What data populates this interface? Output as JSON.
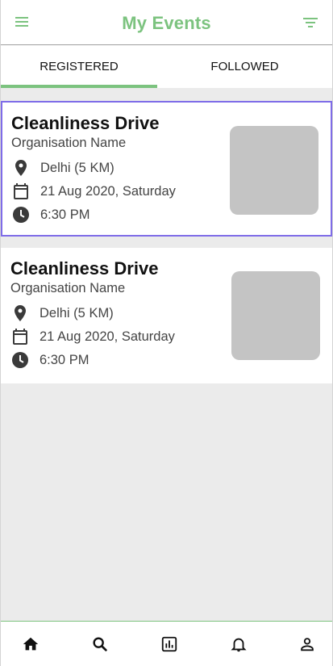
{
  "header": {
    "title": "My Events",
    "menu_icon": "hamburger-menu-icon",
    "filter_icon": "filter-icon"
  },
  "tabs": [
    {
      "label": "REGISTERED",
      "active": true
    },
    {
      "label": "FOLLOWED",
      "active": false
    }
  ],
  "events": [
    {
      "title": "Cleanliness Drive",
      "organisation": "Organisation Name",
      "location": "Delhi (5 KM)",
      "date": "21 Aug 2020, Saturday",
      "time": "6:30 PM",
      "selected": true
    },
    {
      "title": "Cleanliness Drive",
      "organisation": "Organisation Name",
      "location": "Delhi (5 KM)",
      "date": "21 Aug 2020, Saturday",
      "time": "6:30 PM",
      "selected": false
    }
  ],
  "bottom_nav": [
    {
      "icon": "home-icon"
    },
    {
      "icon": "search-icon"
    },
    {
      "icon": "chart-icon"
    },
    {
      "icon": "bell-icon"
    },
    {
      "icon": "profile-icon"
    }
  ],
  "colors": {
    "accent": "#7cc37f",
    "selected_border": "#7f6ce8",
    "background": "#ebebeb",
    "thumbnail": "#c4c4c4"
  }
}
